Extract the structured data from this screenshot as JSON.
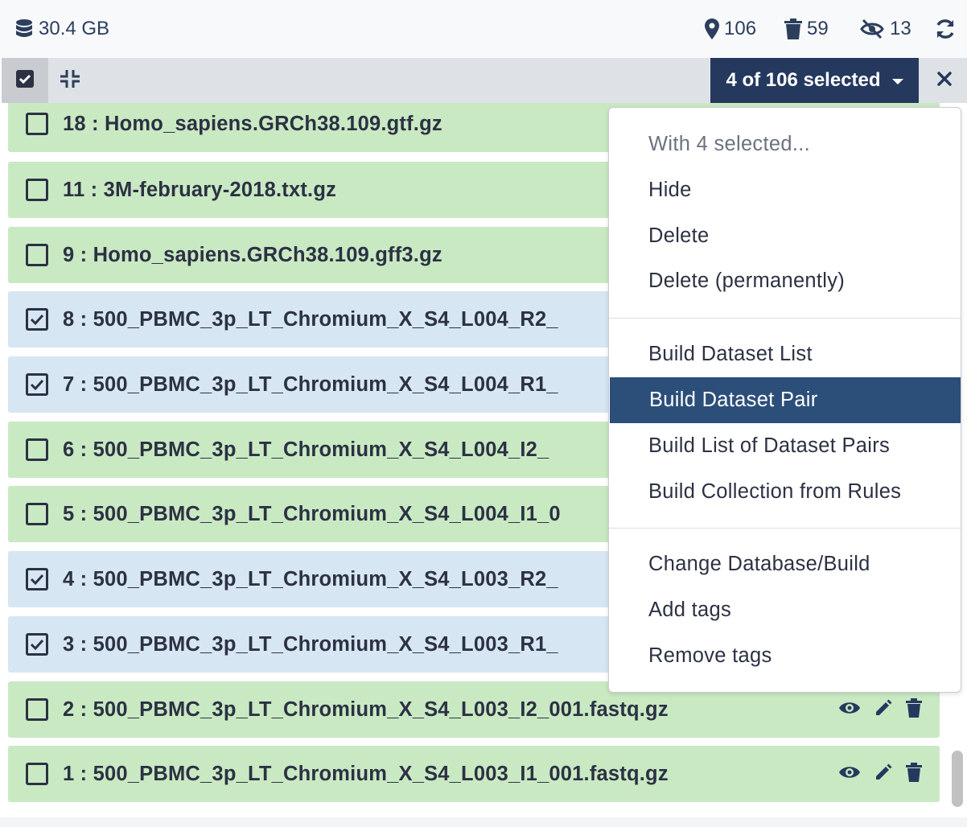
{
  "stats": {
    "size": "30.4 GB",
    "shown": "106",
    "deleted": "59",
    "hidden": "13"
  },
  "selection": {
    "label": "4 of 106 selected"
  },
  "items": [
    {
      "title": "18 : Homo_sapiens.GRCh38.109.gtf.gz",
      "checked": false,
      "state": "ok"
    },
    {
      "title": "11 : 3M-february-2018.txt.gz",
      "checked": false,
      "state": "ok"
    },
    {
      "title": "9 : Homo_sapiens.GRCh38.109.gff3.gz",
      "checked": false,
      "state": "ok"
    },
    {
      "title": "8 : 500_PBMC_3p_LT_Chromium_X_S4_L004_R2_",
      "checked": true,
      "state": "selected"
    },
    {
      "title": "7 : 500_PBMC_3p_LT_Chromium_X_S4_L004_R1_",
      "checked": true,
      "state": "selected"
    },
    {
      "title": "6 : 500_PBMC_3p_LT_Chromium_X_S4_L004_I2_",
      "checked": false,
      "state": "ok"
    },
    {
      "title": "5 : 500_PBMC_3p_LT_Chromium_X_S4_L004_I1_0",
      "checked": false,
      "state": "ok"
    },
    {
      "title": "4 : 500_PBMC_3p_LT_Chromium_X_S4_L003_R2_",
      "checked": true,
      "state": "selected"
    },
    {
      "title": "3 : 500_PBMC_3p_LT_Chromium_X_S4_L003_R1_",
      "checked": true,
      "state": "selected"
    },
    {
      "title": "2 : 500_PBMC_3p_LT_Chromium_X_S4_L003_I2_001.fastq.gz",
      "checked": false,
      "state": "ok"
    },
    {
      "title": "1 : 500_PBMC_3p_LT_Chromium_X_S4_L003_I1_001.fastq.gz",
      "checked": false,
      "state": "ok"
    }
  ],
  "menu": {
    "header": "With 4 selected...",
    "hide": "Hide",
    "delete": "Delete",
    "delete_permanently": "Delete (permanently)",
    "build_list": "Build Dataset List",
    "build_pair": "Build Dataset Pair",
    "build_list_pairs": "Build List of Dataset Pairs",
    "build_rules": "Build Collection from Rules",
    "change_dbkey": "Change Database/Build",
    "add_tags": "Add tags",
    "remove_tags": "Remove tags"
  },
  "colors": {
    "ok_row": "#c9e9c3",
    "selected_row": "#d7e6f3",
    "dark_blue": "#25395e",
    "active_item": "#2c4f7a"
  },
  "icons": [
    "database-icon",
    "map-marker-icon",
    "trash-icon",
    "eye-slash-icon",
    "sync-icon",
    "check-square-icon",
    "compress-icon",
    "caret-down-icon",
    "close-icon",
    "eye-icon",
    "pencil-icon"
  ]
}
